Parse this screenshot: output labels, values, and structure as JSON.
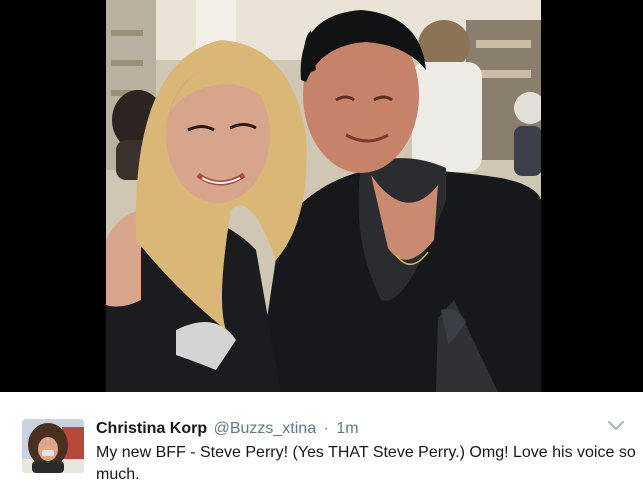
{
  "tweet": {
    "display_name": "Christina Korp",
    "handle": "@Buzzs_xtina",
    "separator": "·",
    "time": "1m",
    "text": "My new BFF - Steve Perry! (Yes THAT Steve Perry.) Omg! Love his voice so much."
  },
  "icons": {
    "more_menu": "chevron-down-icon"
  },
  "colors": {
    "media_background": "#000000",
    "name": "#14171a",
    "secondary_text": "#657786",
    "caret": "#aab8c2"
  }
}
